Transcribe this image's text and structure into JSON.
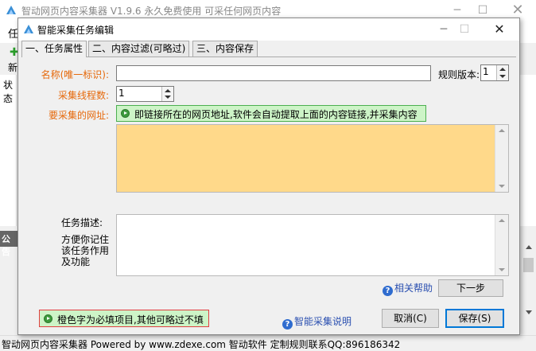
{
  "main_window": {
    "title": "智动网页内容采集器 V1.9.6 永久免费使用 可采任何网页内容",
    "menu_first": "任",
    "side_label": "状态",
    "toolbar_label": "新",
    "announce_label": "公告",
    "status_text": "智动网页内容采集器 Powered by www.zdexe.com 智动软件 定制规则联系QQ:896186342"
  },
  "dialog": {
    "title": "智能采集任务编辑",
    "tabs": [
      {
        "label": "一、任务属性",
        "active": true
      },
      {
        "label": "二、内容过滤(可略过)",
        "active": false
      },
      {
        "label": "三、内容保存",
        "active": false
      }
    ],
    "name_label": "名称(唯一标识):",
    "name_value": "",
    "rule_version_label": "规则版本:",
    "rule_version_value": "1",
    "threads_label": "采集线程数:",
    "threads_value": "1",
    "url_label": "要采集的网址:",
    "url_hint": "即链接所在的网页地址,软件会自动提取上面的内容链接,并采集内容",
    "url_value": "",
    "desc_label": "任务描述:",
    "desc_note": "方便你记住该任务作用及功能",
    "desc_value": "",
    "help_link": "相关帮助",
    "next_button": "下一步",
    "footer_hint": "橙色字为必填项目,其他可略过不填",
    "smart_link": "智能采集说明",
    "cancel_button": "取消(C)",
    "save_button": "保存(S)"
  },
  "colors": {
    "required_label": "#e6690b",
    "url_area_bg": "#ffd98a",
    "hint_bg": "#cdf4c7",
    "link": "#2a4fb0"
  }
}
